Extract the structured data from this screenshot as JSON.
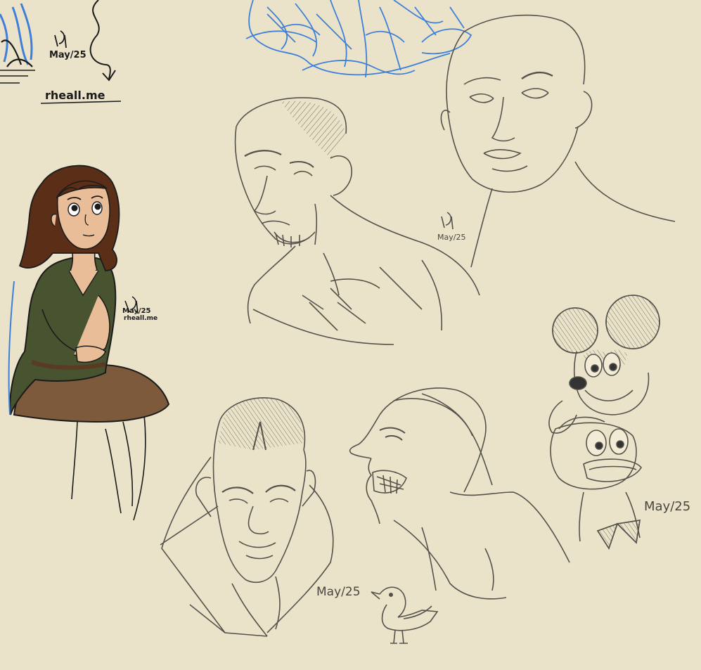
{
  "colors": {
    "paper": "#ebe3c9",
    "pencil": "#55524c",
    "blue_sketch": "#3d7fd9",
    "ink": "#1b1b1b",
    "hair": "#5a2e17",
    "skin": "#e8bd98",
    "tunic": "#48532f",
    "skirt": "#7e5a3c"
  },
  "signature_marks": [
    {
      "date": "May/25"
    },
    {
      "date": "May/25"
    },
    {
      "date": "May/25",
      "site": "rheall.me"
    }
  ],
  "corner_mark": {
    "date": "May/25",
    "site": "rheall.me"
  },
  "dates": [
    "May/25",
    "May/25"
  ]
}
